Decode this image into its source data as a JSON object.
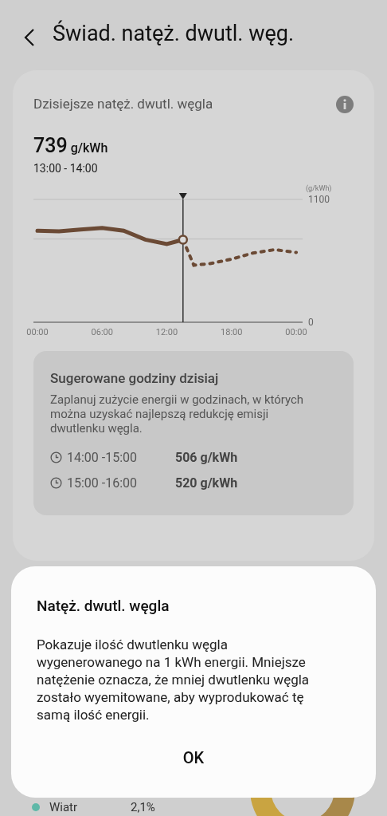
{
  "header": {
    "title": "Świad. natęż. dwutl. węg."
  },
  "card": {
    "title": "Dzisiejsze natęż. dwutl. węgla",
    "value": "739",
    "unit": "g/kWh",
    "range": "13:00 - 14:00",
    "chart_data": {
      "type": "line",
      "ylabel": "(g/kWh)",
      "x": [
        0,
        2,
        4,
        6,
        8,
        10,
        12,
        13.5,
        14.5,
        16,
        18,
        20,
        22,
        24
      ],
      "xlim": [
        -0.37,
        24.59
      ],
      "ref_lines": [
        {
          "axis": "y",
          "value": 745
        },
        {
          "axis": "x",
          "value": 13.5
        }
      ],
      "ylim": [
        0,
        1100
      ],
      "yticks": [
        0,
        1100
      ],
      "xticks": [
        {
          "value": 0,
          "label": "00:00"
        },
        {
          "value": 6,
          "label": "06:00"
        },
        {
          "value": 12,
          "label": "12:00"
        },
        {
          "value": 18,
          "label": "18:00"
        },
        {
          "value": 24,
          "label": "00:00"
        }
      ],
      "series": [
        {
          "color": "#6b4a35",
          "line_style": "solid",
          "values": [
            820,
            815,
            830,
            845,
            820,
            740,
            700,
            739,
            null,
            null,
            null,
            null,
            null,
            null
          ]
        },
        {
          "color": "#6b4a35",
          "line_style": "dashed",
          "values": [
            null,
            null,
            null,
            null,
            null,
            null,
            null,
            739,
            511,
            525,
            565,
            620,
            650,
            625
          ]
        }
      ]
    },
    "suggested": {
      "title": "Sugerowane godziny dzisiaj",
      "description": "Zaplanuj zużycie energii w godzinach, w których można uzyskać najlepszą redukcję emisji dwutlenku węgla.",
      "slots": [
        {
          "time": "14:00 -15:00",
          "value": "506 g/kWh"
        },
        {
          "time": "15:00 -16:00",
          "value": "520 g/kWh"
        }
      ]
    }
  },
  "legend": [
    {
      "label": "Wiatr",
      "value": "2,1%",
      "color": "#5fb8a8"
    }
  ],
  "dialog": {
    "title": "Natęż. dwutl. węgla",
    "body": "Pokazuje ilość dwutlenku węgla wygenerowanego na 1 kWh energii. Mniejsze natężenie oznacza, że mniej dwutlenku węgla zostało wyemitowane, aby wyprodukować tę samą ilość energii.",
    "button": "OK"
  }
}
